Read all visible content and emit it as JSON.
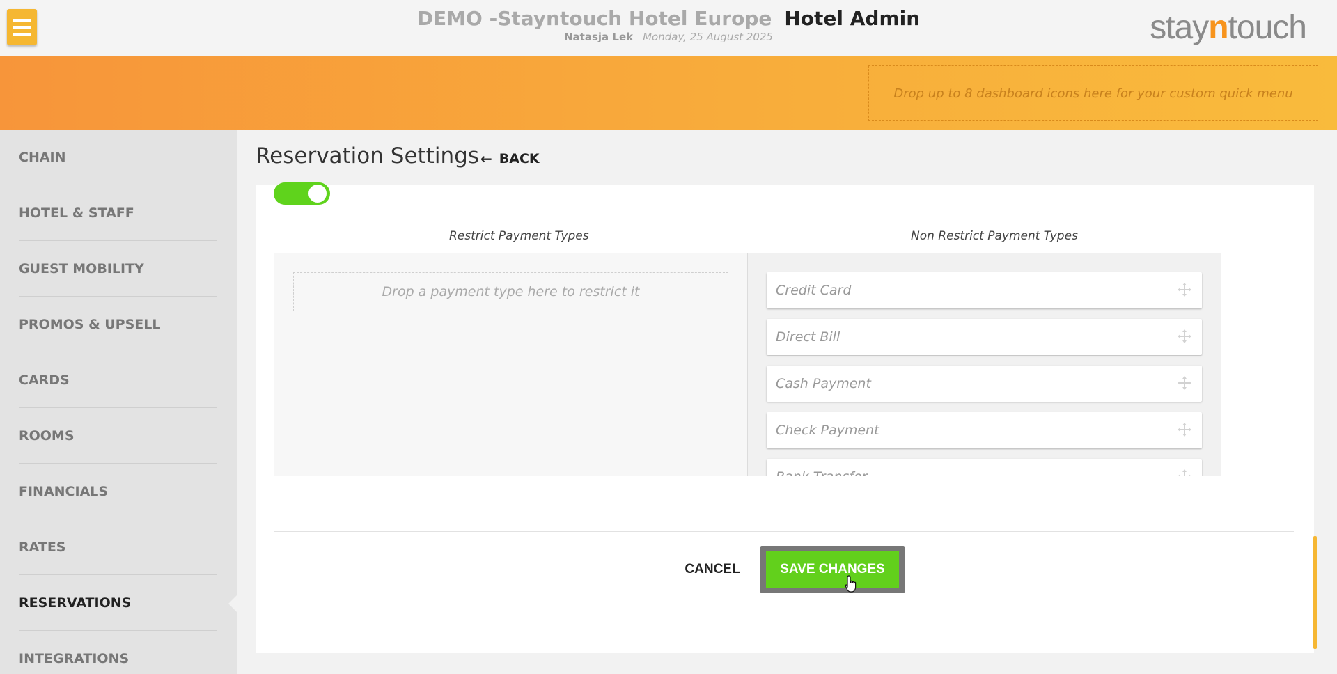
{
  "header": {
    "hotel_name": "DEMO -Stayntouch Hotel Europe",
    "app_name": "Hotel Admin",
    "user_name": "Natasja Lek",
    "date": "Monday, 25 August 2025",
    "logo": {
      "prefix": "stay",
      "accent": "n",
      "suffix": "touch"
    },
    "menu_icon": "hamburger-icon"
  },
  "quick_menu": {
    "placeholder": "Drop up to 8 dashboard icons here for your custom quick menu"
  },
  "sidebar": {
    "items": [
      {
        "label": "CHAIN",
        "active": false
      },
      {
        "label": "HOTEL & STAFF",
        "active": false
      },
      {
        "label": "GUEST MOBILITY",
        "active": false
      },
      {
        "label": "PROMOS & UPSELL",
        "active": false
      },
      {
        "label": "CARDS",
        "active": false
      },
      {
        "label": "ROOMS",
        "active": false
      },
      {
        "label": "FINANCIALS",
        "active": false
      },
      {
        "label": "RATES",
        "active": false
      },
      {
        "label": "RESERVATIONS",
        "active": true
      },
      {
        "label": "INTEGRATIONS",
        "active": false
      }
    ]
  },
  "page": {
    "title": "Reservation Settings",
    "back_label": "BACK",
    "back_icon": "arrow-left-icon"
  },
  "settings": {
    "toggle_on": true,
    "restrict_title": "Restrict Payment Types",
    "nonrestrict_title": "Non Restrict Payment Types",
    "restrict_placeholder": "Drop a payment type here to restrict it",
    "restricted_types": [],
    "nonrestricted_types": [
      "Credit Card",
      "Direct Bill",
      "Cash Payment",
      "Check Payment",
      "Bank Transfer"
    ],
    "item_icon": "move-icon"
  },
  "actions": {
    "cancel_label": "CANCEL",
    "save_label": "SAVE CHANGES"
  },
  "colors": {
    "accent_orange": "#f7953a",
    "accent_yellow": "#f5b732",
    "save_green": "#62d01c",
    "toggle_green": "#5fd31c"
  }
}
